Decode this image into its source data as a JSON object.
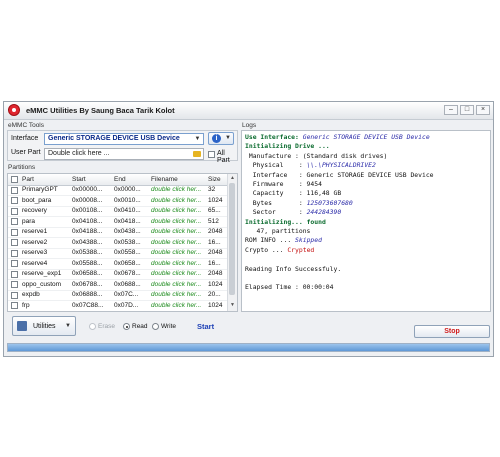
{
  "window": {
    "title": "eMMC Utilities  By Saung Baca Tarik Kolot"
  },
  "emmc_tools": {
    "label": "eMMC Tools",
    "interface_label": "Interface",
    "interface_value": "Generic STORAGE DEVICE USB Device",
    "user_part_label": "User Part",
    "user_part_value": "Double click here ...",
    "all_part_label": "All Part"
  },
  "partitions": {
    "label": "Partitions",
    "columns": [
      "Part",
      "Start",
      "End",
      "Filename",
      "Size"
    ],
    "rows": [
      {
        "part": "PrimaryGPT",
        "start": "0x00000...",
        "end": "0x0000...",
        "file": "double click her...",
        "size": "32"
      },
      {
        "part": "boot_para",
        "start": "0x00008...",
        "end": "0x0010...",
        "file": "double click her...",
        "size": "1024"
      },
      {
        "part": "recovery",
        "start": "0x00108...",
        "end": "0x0410...",
        "file": "double click her...",
        "size": "65..."
      },
      {
        "part": "para",
        "start": "0x04108...",
        "end": "0x0418...",
        "file": "double click her...",
        "size": "512"
      },
      {
        "part": "reserve1",
        "start": "0x04188...",
        "end": "0x0438...",
        "file": "double click her...",
        "size": "2048"
      },
      {
        "part": "reserve2",
        "start": "0x04388...",
        "end": "0x0538...",
        "file": "double click her...",
        "size": "16..."
      },
      {
        "part": "reserve3",
        "start": "0x05388...",
        "end": "0x0558...",
        "file": "double click her...",
        "size": "2048"
      },
      {
        "part": "reserve4",
        "start": "0x05588...",
        "end": "0x0658...",
        "file": "double click her...",
        "size": "16..."
      },
      {
        "part": "reserve_exp1",
        "start": "0x06588...",
        "end": "0x0678...",
        "file": "double click her...",
        "size": "2048"
      },
      {
        "part": "oppo_custom",
        "start": "0x06788...",
        "end": "0x0688...",
        "file": "double click her...",
        "size": "1024"
      },
      {
        "part": "expdb",
        "start": "0x06888...",
        "end": "0x07C...",
        "file": "double click her...",
        "size": "20..."
      },
      {
        "part": "frp",
        "start": "0x07C88...",
        "end": "0x07D...",
        "file": "double click her...",
        "size": "1024"
      }
    ]
  },
  "actions": {
    "utilities_label": "Utilities",
    "erase_label": "Erase",
    "read_label": "Read",
    "write_label": "Write",
    "start_label": "Start",
    "stop_label": "Stop"
  },
  "logs": {
    "label": "Logs",
    "lines": [
      {
        "k": "Use Interface: ",
        "v": "Generic STORAGE DEVICE USB Device",
        "style": "key-val"
      },
      {
        "k": "Initializing Drive ...",
        "v": "",
        "style": "key"
      },
      {
        "k": " Manufacture : (Standard disk drives)",
        "v": "",
        "style": "plain"
      },
      {
        "k": "  Physical    : ",
        "v": "\\\\.\\PHYSICALDRIVE2",
        "style": "plain-val"
      },
      {
        "k": "  Interface   : Generic STORAGE DEVICE USB Device",
        "v": "",
        "style": "plain"
      },
      {
        "k": "  Firmware    : 9454",
        "v": "",
        "style": "plain"
      },
      {
        "k": "  Capacity    : 116,48 GB",
        "v": "",
        "style": "plain"
      },
      {
        "k": "  Bytes       : ",
        "v": "125073607680",
        "style": "plain-val"
      },
      {
        "k": "  Sector      : ",
        "v": "244284390",
        "style": "plain-val"
      },
      {
        "k": "Initializing... ",
        "v": "found",
        "style": "key-val"
      },
      {
        "k": "   47, partitions",
        "v": "",
        "style": "plain"
      },
      {
        "k": "ROM INFO ... ",
        "v": "Skipped",
        "style": "plain-val"
      },
      {
        "k": "Crypto ... ",
        "v": "Crypted",
        "style": "plain-red"
      },
      {
        "k": "",
        "v": "",
        "style": "plain"
      },
      {
        "k": "Reading Info Successfuly.",
        "v": "",
        "style": "plain"
      },
      {
        "k": "",
        "v": "",
        "style": "plain"
      },
      {
        "k": "Elapsed Time : 00:00:04",
        "v": "",
        "style": "plain"
      }
    ]
  },
  "progress": {
    "fraction": 1.0
  },
  "colors": {
    "accent": "#1c3fb5",
    "stop": "#d01a1a",
    "found": "#0a6b2e",
    "log_value": "#2a2aa8"
  }
}
